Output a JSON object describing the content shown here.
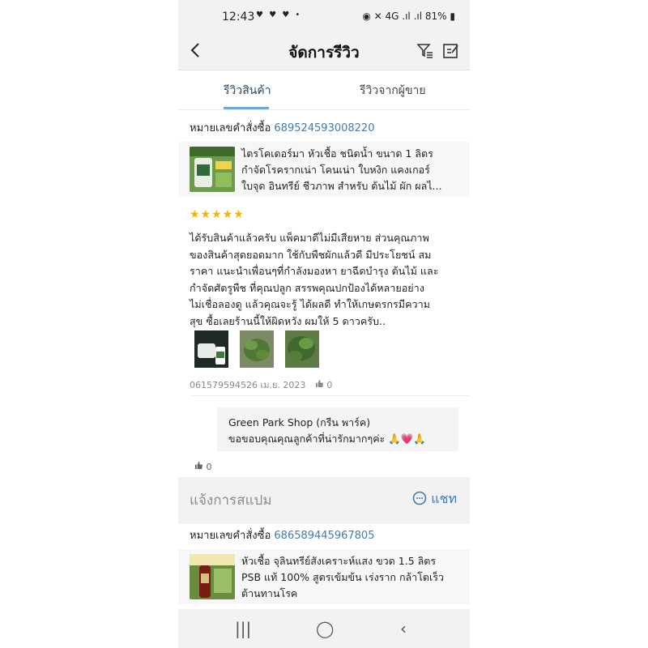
{
  "status_bar": {
    "time": "12:43",
    "left_icons": "♥ ♥ ♥ •",
    "battery": "81%",
    "right_icons": "◉ ✕ 4G .ıl .ıl"
  },
  "header": {
    "title": "จัดการรีวิว",
    "back_icon": "chevron-left-icon",
    "filter_icon": "filter-icon",
    "edit_icon": "edit-icon"
  },
  "tabs": [
    {
      "label": "รีวิวสินค้า",
      "active": true
    },
    {
      "label": "รีวิวจากผู้ขาย",
      "active": false
    }
  ],
  "colors": {
    "accent": "#3e7cb1",
    "tab_underline": "#6fa7d6",
    "star": "#f6b400",
    "background_gray": "#f2f2f2"
  },
  "review1": {
    "order_label": "หมายเลขคำสั่งซื้อ",
    "order_number": "689524593008220",
    "product_lines": [
      "ไตรโคเดอร์มา หัวเชื้อ ชนิดน้ำ ขนาด 1 ลิตร",
      "กำจัดโรครากเน่า โคนเน่า ใบหงิก แคงเกอร์",
      "ใบจุด อินทรีย์ ชีวภาพ สำหรับ ต้นไม้ ผัก ผลไ..."
    ],
    "rating": 5,
    "stars": "★★★★★",
    "review_lines": [
      "ได้รับสินค้าแล้วครับ แพ็คมาดีไม่มีเสียหาย ส่วนคุณภาพ",
      "ของสินค้าสุดยอดมาก ใช้กับพืชผักแล้วดี มีประโยชน์ สม",
      "ราคา แนะนำเพื่อนๆที่กำลังมองหา ยาฉีดบำรุง ต้นไม้ และ",
      "กำจัดศัตรูพืช ที่คุณปลูก สรรพคุณปกป้องได้หลายอย่าง",
      "ไม่เชื่อลองดู แล้วคุณจะรู้ ได้ผลดี ทำให้เกษตรกรมีความ",
      "สุข ซื้อเลยร้านนี้ให้ผิดหวัง ผมให้ 5 ดาวครับ.."
    ],
    "meta": "061579594526 เม.ย. 2023",
    "likes": "0",
    "shop_name": "Green Park Shop (กรีน พาร์ค)",
    "shop_reply": "ขอขอบคุณคุณลูกค้าที่น่ารักมากๆค่ะ 🙏💗🙏",
    "reply_likes": "0"
  },
  "spam": {
    "label": "แจ้งการสแปม",
    "chat_label": "แชท",
    "chat_icon": "chat-bubble-icon"
  },
  "review2": {
    "order_label": "หมายเลขคำสั่งซื้อ",
    "order_number": "686589445967805",
    "product_lines": [
      "หัวเชื้อ จุลินทรีย์สังเคราะห์แสง ขวด 1.5 ลิตร",
      "PSB แท้ 100% สูตรเข้มข้น เร่งราก กล้าโตเร็ว",
      "ต้านทานโรค"
    ]
  },
  "nav": {
    "recent": "|||",
    "home": "◯",
    "back": "‹"
  }
}
